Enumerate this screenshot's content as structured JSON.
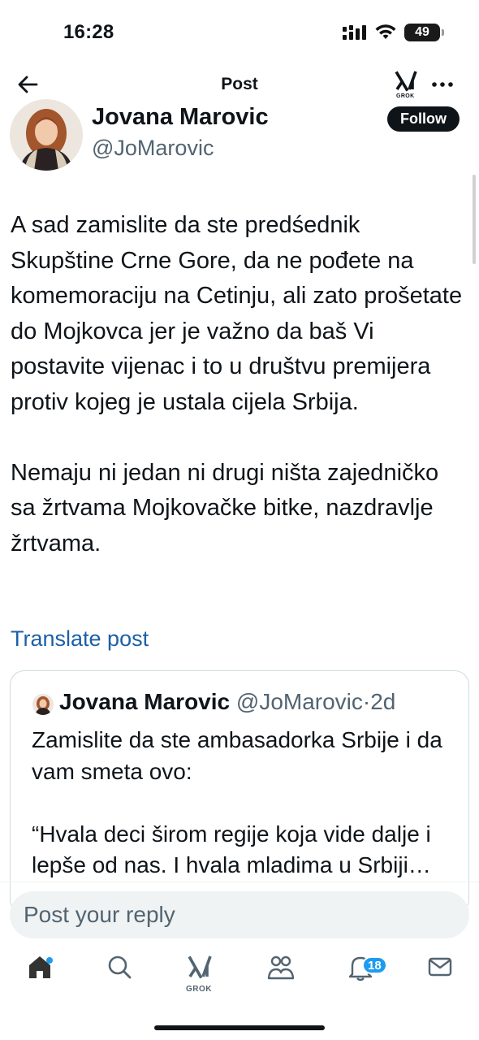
{
  "status_bar": {
    "time": "16:28",
    "battery": "49"
  },
  "nav": {
    "title": "Post",
    "grok_label": "GROK",
    "back_icon": "arrow-left-icon",
    "more_icon": "ellipsis-icon"
  },
  "post": {
    "author_name": "Jovana Marovic",
    "author_handle": "@JoMarovic",
    "follow_label": "Follow",
    "paragraphs": [
      "A sad zamislite da ste predśednik Skupštine Crne Gore, da ne pođete na komemoraciju na Cetinju, ali zato prošetate do Mojkovca jer je važno da baš Vi postavite vijenac i to u društvu premijera protiv kojeg je ustala cijela Srbija.",
      "Nemaju ni jedan ni drugi ništa zajedničko sa žrtvama Mojkovačke bitke, nazdravlje žrtvama."
    ],
    "translate_label": "Translate post"
  },
  "quoted_post": {
    "author_name": "Jovana Marovic",
    "author_handle": "@JoMarovic",
    "separator": "·",
    "age": "2d",
    "paragraphs": [
      "Zamislite da ste ambasadorka Srbije i da vam smeta ovo:",
      "“Hvala deci širom regije koja vide dalje i lepše od nas. I hvala mladima u Srbiji…"
    ]
  },
  "reply": {
    "placeholder": "Post your reply"
  },
  "tab_bar": {
    "grok_label": "GROK",
    "notifications_count": "18",
    "icons": [
      "home-icon",
      "search-icon",
      "grok-icon",
      "communities-icon",
      "notifications-icon",
      "messages-icon"
    ]
  },
  "colors": {
    "text": "#0f1419",
    "secondary": "#536471",
    "link": "#1d5fa6",
    "accent": "#1d9bf0",
    "follow_bg": "#0f1419"
  }
}
